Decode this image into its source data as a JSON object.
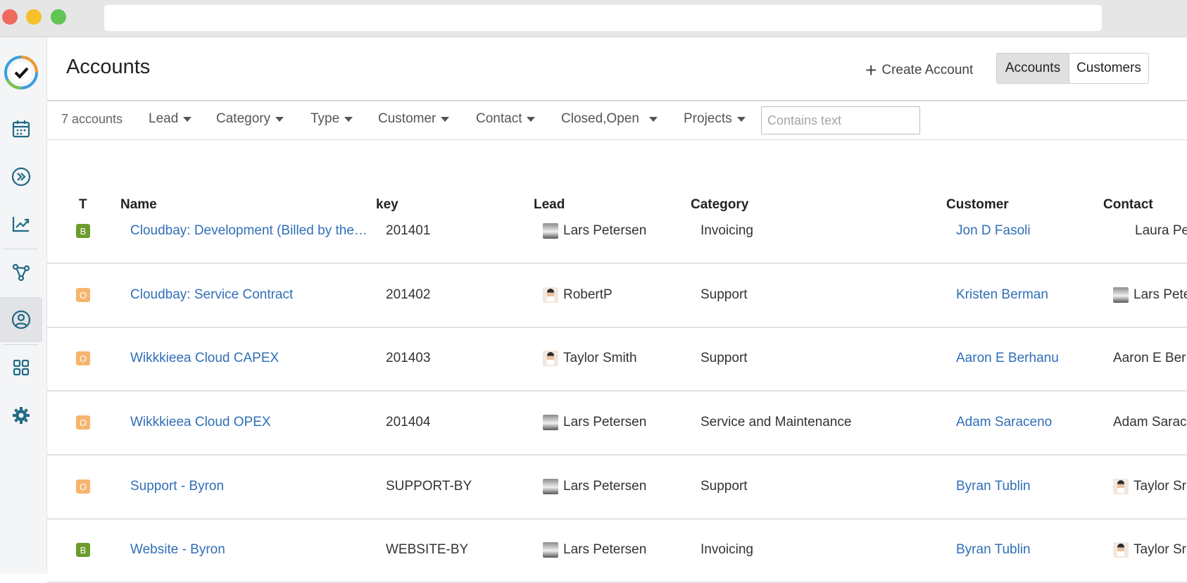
{
  "app": {
    "title": "Accounts"
  },
  "header": {
    "create_label": "Create Account",
    "toggle": {
      "accounts": "Accounts",
      "customers": "Customers",
      "active": "Accounts"
    }
  },
  "sidebar": {
    "items": [
      {
        "icon": "logo-check-icon",
        "label": ""
      },
      {
        "icon": "calendar-icon"
      },
      {
        "icon": "forward-circle-icon"
      },
      {
        "icon": "chart-trend-icon"
      },
      {
        "icon": "graph-nodes-icon"
      },
      {
        "icon": "user-circle-icon",
        "active": true
      },
      {
        "icon": "grid-apps-icon"
      },
      {
        "icon": "gear-icon"
      }
    ]
  },
  "filters": {
    "count": "7 accounts",
    "items": [
      "Lead",
      "Category",
      "Type",
      "Customer",
      "Contact",
      "Closed,Open",
      "Projects"
    ],
    "search_placeholder": "Contains text"
  },
  "table": {
    "columns": [
      "T",
      "Name",
      "key",
      "Lead",
      "Category",
      "Customer",
      "Contact"
    ],
    "rows": [
      {
        "t": "B",
        "name": "Cloudbay: Development (Billed by the…",
        "key": "201401",
        "lead": "Lars Petersen",
        "category": "Invoicing",
        "customer": "Jon D Fasoli",
        "contact": "Laura Pe"
      },
      {
        "t": "O",
        "name": "Cloudbay: Service Contract",
        "key": "201402",
        "lead": "RobertP",
        "category": "Support",
        "customer": "Kristen Berman",
        "contact": "Lars Pete"
      },
      {
        "t": "O",
        "name": "Wikkkieea Cloud CAPEX",
        "key": "201403",
        "lead": "Taylor Smith",
        "category": "Support",
        "customer": "Aaron E Berhanu",
        "contact": "Aaron E Ber"
      },
      {
        "t": "O",
        "name": "Wikkkieea Cloud OPEX",
        "key": "201404",
        "lead": "Lars Petersen",
        "category": "Service and Maintenance",
        "customer": "Adam Saraceno",
        "contact": "Adam Sarac"
      },
      {
        "t": "O",
        "name": "Support - Byron",
        "key": "SUPPORT-BY",
        "lead": "Lars Petersen",
        "category": "Support",
        "customer": "Byran Tublin",
        "contact": "Taylor Sr"
      },
      {
        "t": "B",
        "name": "Website - Byron",
        "key": "WEBSITE-BY",
        "lead": "Lars Petersen",
        "category": "Invoicing",
        "customer": "Byran Tublin",
        "contact": "Taylor Sr"
      }
    ]
  },
  "colors": {
    "link": "#2f6fb6",
    "badge_B": "#6c9b2e",
    "badge_O": "#f5b56e"
  }
}
